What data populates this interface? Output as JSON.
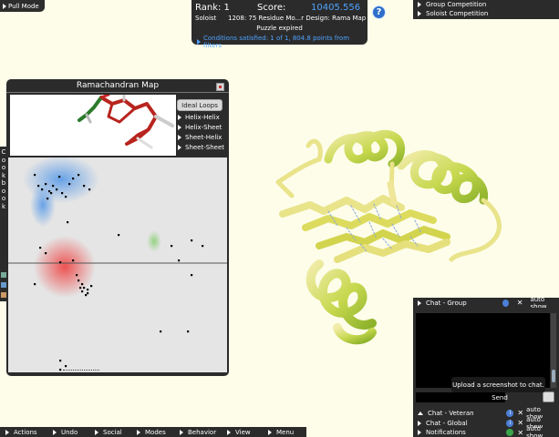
{
  "pull_mode": {
    "label": "Pull Mode"
  },
  "score_panel": {
    "rank_label": "Rank: 1",
    "score_label": "Score:",
    "score_value": "10405.556",
    "role": "Soloist",
    "puzzle_title": "1208: 75 Residue Mo...r Design: Rama Map",
    "status": "Puzzle expired",
    "conditions": "Conditions satisfied: 1 of 1, 804.8 points from filters"
  },
  "help": {
    "icon": "question-icon",
    "glyph": "?"
  },
  "competitions": [
    {
      "label": "Group Competition"
    },
    {
      "label": "Soloist Competition"
    }
  ],
  "rama_map": {
    "title": "Ramachandran Map",
    "ideal_loops_label": "Ideal Loops",
    "loop_types": [
      "Helix-Helix",
      "Helix-Sheet",
      "Sheet-Helix",
      "Sheet-Sheet"
    ],
    "colors": {
      "helix_region": "#5a9be8",
      "sheet_region": "#ee4a4a",
      "left_helix_region": "#8fd17a",
      "point": "#000000"
    }
  },
  "cookbook": {
    "label": "Cookbook"
  },
  "bottom_toolbar": [
    "Actions",
    "Undo",
    "Social",
    "Modes",
    "Behavior",
    "View",
    "Menu"
  ],
  "chat": {
    "group_tab": "Chat - Group",
    "tooltip": "Upload a screenshot to chat.",
    "send_label": "Send",
    "rows": [
      {
        "label": "Chat - Veteran",
        "auto": "auto show"
      },
      {
        "label": "Chat - Global",
        "auto": "auto show"
      },
      {
        "label": "Notifications",
        "auto": "auto show"
      }
    ],
    "group_auto": "auto show"
  },
  "colors": {
    "panel_bg": "#2b2b2b",
    "background": "#fdfde9",
    "score_blue": "#4fa3ff",
    "protein_green": "#a3c93a",
    "protein_yellow": "#e9e38a"
  }
}
